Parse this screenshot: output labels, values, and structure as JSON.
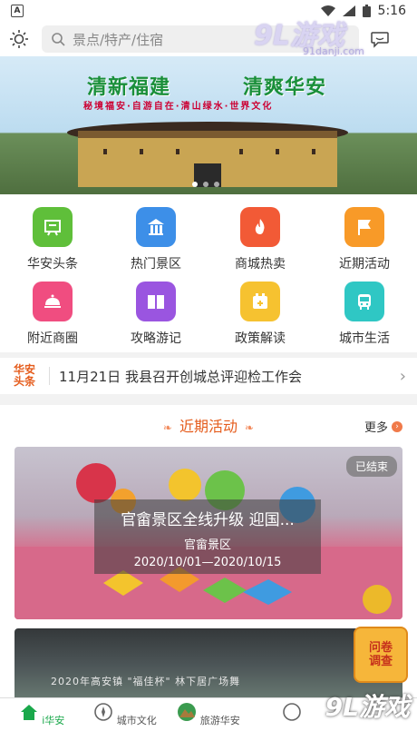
{
  "status_bar": {
    "time": "5:16",
    "left_icon": "A"
  },
  "search": {
    "placeholder": "景点/特产/住宿"
  },
  "watermark_top": {
    "big": "9L游戏",
    "small": "91danji.com"
  },
  "banner": {
    "title_left": "清新福建",
    "title_right": "清爽华安",
    "subtitle": "秘境福安·自游自在·清山绿水·世界文化"
  },
  "grid": {
    "items": [
      {
        "label": "华安头条",
        "icon": "newspaper-icon",
        "color": "#5fbf3a"
      },
      {
        "label": "热门景区",
        "icon": "scenic-icon",
        "color": "#3d8fe8"
      },
      {
        "label": "商城热卖",
        "icon": "fire-icon",
        "color": "#f25a36"
      },
      {
        "label": "近期活动",
        "icon": "flag-icon",
        "color": "#f89a28"
      },
      {
        "label": "附近商圈",
        "icon": "dish-icon",
        "color": "#f04d80"
      },
      {
        "label": "攻略游记",
        "icon": "book-icon",
        "color": "#9a55e0"
      },
      {
        "label": "政策解读",
        "icon": "policy-icon",
        "color": "#f6c230"
      },
      {
        "label": "城市生活",
        "icon": "bus-icon",
        "color": "#2fc7c4"
      }
    ]
  },
  "news": {
    "logo_line1": "华安",
    "logo_line2": "头条",
    "text": "11月21日 我县召开创城总评迎检工作会"
  },
  "section": {
    "title": "近期活动",
    "more": "更多"
  },
  "card1": {
    "badge": "已结束",
    "title": "官畲景区全线升级  迎国...",
    "location": "官畲景区",
    "date": "2020/10/01—2020/10/15"
  },
  "card2": {
    "badge": "已",
    "text": "2020年高安镇 \"福佳杯\" 林下居广场舞"
  },
  "survey": {
    "line1": "问卷",
    "line2": "调查"
  },
  "nav": {
    "items": [
      {
        "label": "i华安"
      },
      {
        "label": "城市文化"
      },
      {
        "label": "旅游华安"
      },
      {
        "label": ""
      },
      {
        "label": ""
      }
    ]
  },
  "watermark_bottom": {
    "big": "9L游戏",
    "small": "91danji.com"
  }
}
